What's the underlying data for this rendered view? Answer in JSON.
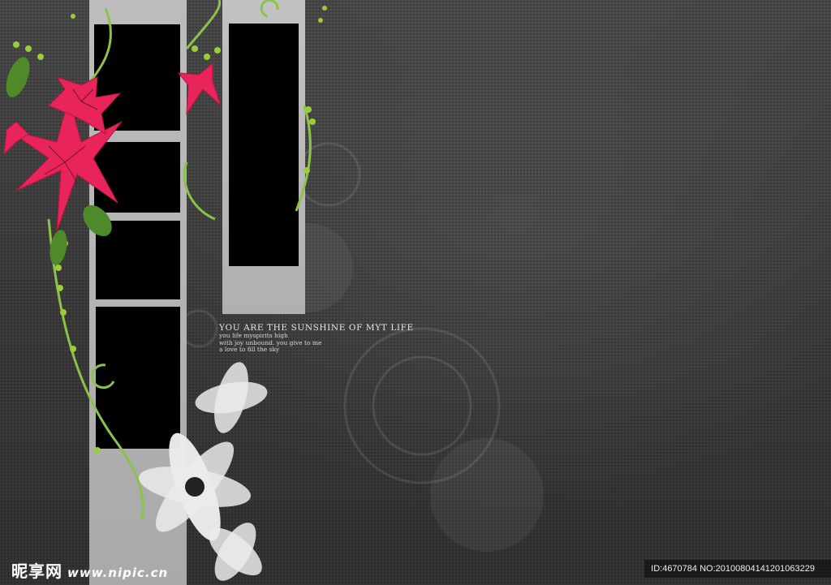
{
  "caption": {
    "heading": "YOU ARE THE SUNSHINE OF MYT LIFE",
    "lines": [
      "you life myspirits high",
      "with joy unbound. you give to me",
      "a love to fill the sky"
    ]
  },
  "watermark": {
    "brand": "昵享网",
    "url": "www.nipic.cn",
    "id_text": "ID:4670784 NO:20100804141201063229"
  },
  "colors": {
    "background": "#3a3a3a",
    "flower_red": "#e8245a",
    "vine_green": "#8bc34a",
    "photo_slot": "#000000"
  }
}
